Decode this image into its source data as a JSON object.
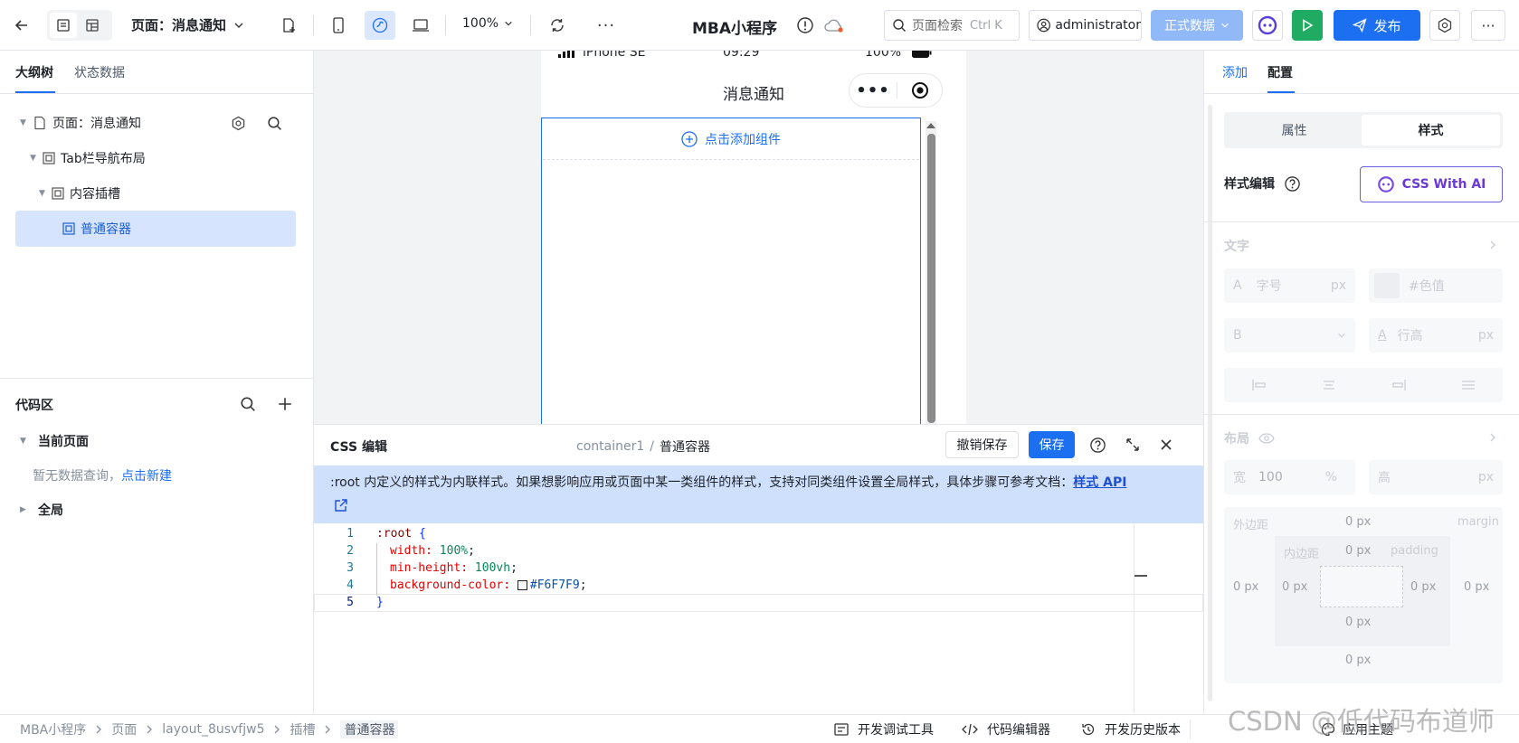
{
  "topbar": {
    "page_select": "页面：消息通知",
    "zoom": "100%",
    "app_title": "MBA小程序",
    "search_placeholder": "页面检索",
    "search_shortcut": "Ctrl K",
    "user": "administrator",
    "env": "正式数据",
    "publish": "发布"
  },
  "left": {
    "tabs": [
      "大纲树",
      "状态数据"
    ],
    "tree": [
      "页面：消息通知",
      "Tab栏导航布局",
      "内容插槽",
      "普通容器"
    ],
    "code_title": "代码区",
    "current_page": "当前页面",
    "empty_text": "暂无数据查询，",
    "new_link": "点击新建",
    "global": "全局"
  },
  "phone": {
    "carrier": "iPhone SE",
    "time": "09:29",
    "battery": "100%",
    "title": "消息通知",
    "add_component": "点击添加组件"
  },
  "css_editor": {
    "title": "CSS 编辑",
    "crumb_1": "container1",
    "crumb_sep": "/",
    "crumb_2": "普通容器",
    "undo": "撤销保存",
    "save": "保存",
    "notice": ":root 内定义的样式为内联样式。如果想影响应用或页面中某一类组件的样式，支持对同类组件设置全局样式，具体步骤可参考文档：",
    "notice_link": "样式 API",
    "lines": [
      {
        "n": "1",
        "sel": ":root ",
        "brace": "{"
      },
      {
        "n": "2",
        "prop": "width: ",
        "val": "100%",
        "end": ";"
      },
      {
        "n": "3",
        "prop": "min-height: ",
        "val": "100vh",
        "end": ";"
      },
      {
        "n": "4",
        "prop": "background-color: ",
        "val": "#F6F7F9",
        "end": ";"
      },
      {
        "n": "5",
        "brace": "}"
      }
    ]
  },
  "right": {
    "tabs": [
      "添加",
      "配置"
    ],
    "seg": [
      "属性",
      "样式"
    ],
    "style_edit": "样式编辑",
    "css_ai": "CSS With AI",
    "text_section": "文字",
    "font_size_ph": "字号",
    "unit_px": "px",
    "color_ph": "#色值",
    "line_height_ph": "行高",
    "layout_section": "布局",
    "width_label": "宽",
    "width_val": "100",
    "width_unit": "%",
    "height_label": "高",
    "margin_label": "外边距",
    "margin_en": "margin",
    "padding_label": "内边距",
    "padding_en": "padding",
    "zero_px": "0 px"
  },
  "bottom": {
    "crumbs": [
      "MBA小程序",
      "页面",
      "layout_8usvfjw5",
      "插槽",
      "普通容器"
    ],
    "dev_tools": "开发调试工具",
    "code_editor": "代码编辑器",
    "history": "开发历史版本",
    "theme": "应用主题",
    "watermark": "CSDN @低代码布道师"
  },
  "colors": {
    "primary": "#1d6ff2",
    "run": "#1fab62",
    "env": "#91b9f7"
  }
}
